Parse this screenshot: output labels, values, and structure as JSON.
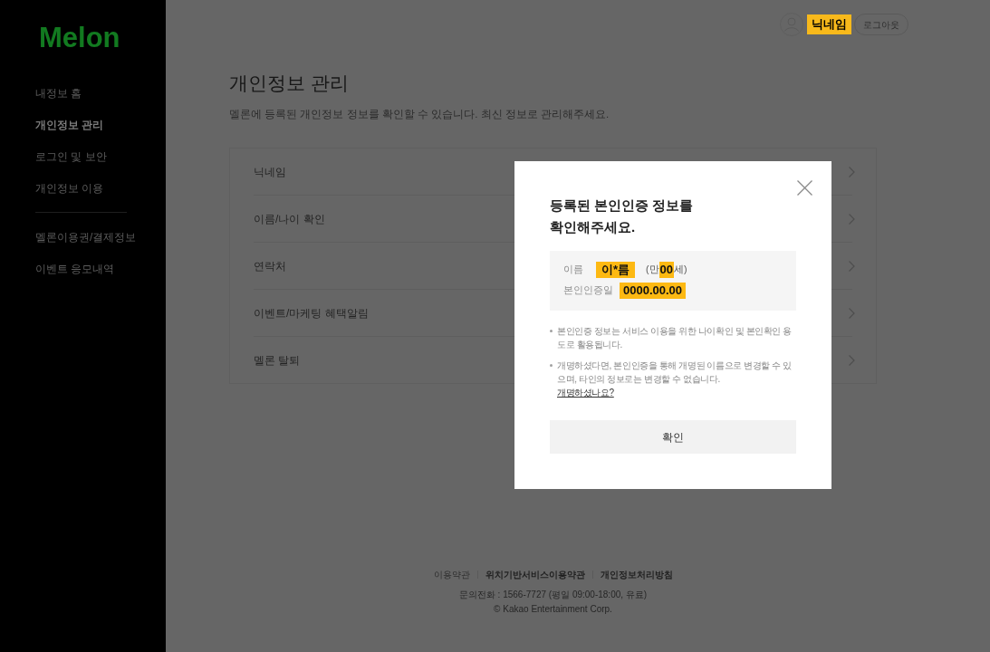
{
  "sidebar": {
    "logo": "Melon",
    "groups": [
      [
        {
          "label": "내정보 홈",
          "selected": false
        },
        {
          "label": "개인정보 관리",
          "selected": true
        },
        {
          "label": "로그인 및 보안",
          "selected": false
        },
        {
          "label": "개인정보 이용",
          "selected": false
        }
      ],
      [
        {
          "label": "멜론이용권/결제정보",
          "selected": false
        },
        {
          "label": "이벤트 응모내역",
          "selected": false
        }
      ]
    ]
  },
  "header": {
    "nickname": "닉네임",
    "logout": "로그아웃"
  },
  "page": {
    "title": "개인정보 관리",
    "description": "멜론에 등록된 개인정보 정보를 확인할 수 있습니다. 최신 정보로 관리해주세요.",
    "menu": [
      {
        "label": "닉네임"
      },
      {
        "label": "이름/나이 확인"
      },
      {
        "label": "연락처"
      },
      {
        "label": "이벤트/마케팅 혜택알림"
      },
      {
        "label": "멜론 탈퇴"
      }
    ]
  },
  "footer": {
    "links": [
      {
        "label": "이용약관",
        "bold": false
      },
      {
        "label": "위치기반서비스이용약관",
        "bold": true
      },
      {
        "label": "개인정보처리방침",
        "bold": true
      }
    ],
    "contact": "문의전화 : 1566-7727 (평일 09:00-18:00, 유료)",
    "copyright": "© Kakao Entertainment Corp."
  },
  "dialog": {
    "title": "등록된 본인인증 정보를\n확인해주세요.",
    "fields": [
      {
        "label": "이름",
        "value": "이*름",
        "age": {
          "before": "(만",
          "highlighted": "00",
          "after": "세)"
        }
      },
      {
        "label": "본인인증일",
        "value": "0000.00.00"
      }
    ],
    "notes": [
      {
        "text": "본인인증 정보는 서비스 이용을 위한 나이확인 및 본인확인 용도로 활용됩니다."
      },
      {
        "text": "개명하셨다면, 본인인증을 통해 개명된 이름으로 변경할 수 있으며, 타인의 정보로는 변경할 수 없습니다.",
        "link": "개명하셨나요?"
      }
    ],
    "confirm": "확인"
  }
}
